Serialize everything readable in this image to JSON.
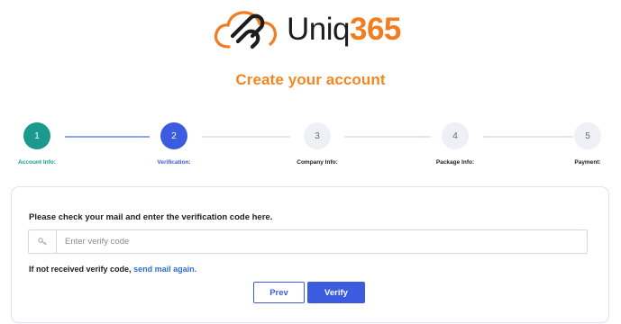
{
  "brand": {
    "name_part1": "Uniq",
    "name_part2": "365"
  },
  "page": {
    "title": "Create your account"
  },
  "steps": [
    {
      "number": "1",
      "label": "Account Info:",
      "state": "done",
      "color": "#1a9a8e"
    },
    {
      "number": "2",
      "label": "Verification:",
      "state": "active",
      "color": "#3c5ce0"
    },
    {
      "number": "3",
      "label": "Company Info:",
      "state": "todo"
    },
    {
      "number": "4",
      "label": "Package Info:",
      "state": "todo"
    },
    {
      "number": "5",
      "label": "Payment:",
      "state": "todo"
    }
  ],
  "verification": {
    "instruction": "Please check your mail and enter the verification code here.",
    "input_icon": "key-icon",
    "input_placeholder": "Enter verify code",
    "input_value": "",
    "resend_text": "If not received verify code,",
    "resend_link": "send mail again.",
    "prev_label": "Prev",
    "verify_label": "Verify"
  },
  "colors": {
    "accent_orange": "#f5861f",
    "primary_blue": "#3c5ce0",
    "done_teal": "#1a9a8e",
    "link_blue": "#2f6fd1"
  }
}
